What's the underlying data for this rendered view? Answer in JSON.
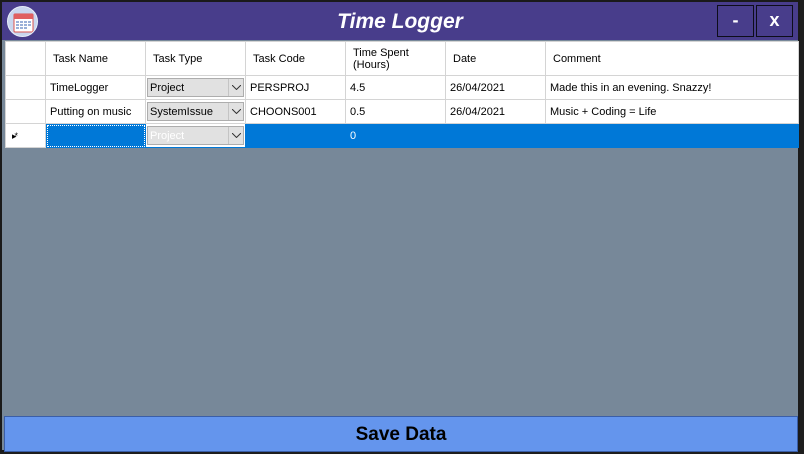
{
  "window": {
    "title": "Time Logger",
    "minimize_label": "-",
    "close_label": "x",
    "app_icon": "calendar-icon"
  },
  "grid": {
    "columns": [
      "Task Name",
      "Task Type",
      "Task Code",
      "Time Spent (Hours)",
      "Date",
      "Comment"
    ],
    "rows": [
      {
        "task_name": "TimeLogger",
        "task_type": "Project",
        "task_code": "PERSPROJ",
        "time_spent": "4.5",
        "date": "26/04/2021",
        "comment": "Made this in an evening. Snazzy!"
      },
      {
        "task_name": "Putting on music",
        "task_type": "SystemIssue",
        "task_code": "CHOONS001",
        "time_spent": "0.5",
        "date": "26/04/2021",
        "comment": "Music + Coding = Life"
      }
    ],
    "new_row": {
      "marker": "▸*",
      "task_name": "",
      "task_type": "Project",
      "task_code": "",
      "time_spent": "0",
      "date": "",
      "comment": ""
    }
  },
  "save_button": {
    "label": "Save Data"
  },
  "colors": {
    "titlebar": "#483d8b",
    "background": "#778899",
    "selection": "#0078d7",
    "save_button": "#6495ed"
  }
}
